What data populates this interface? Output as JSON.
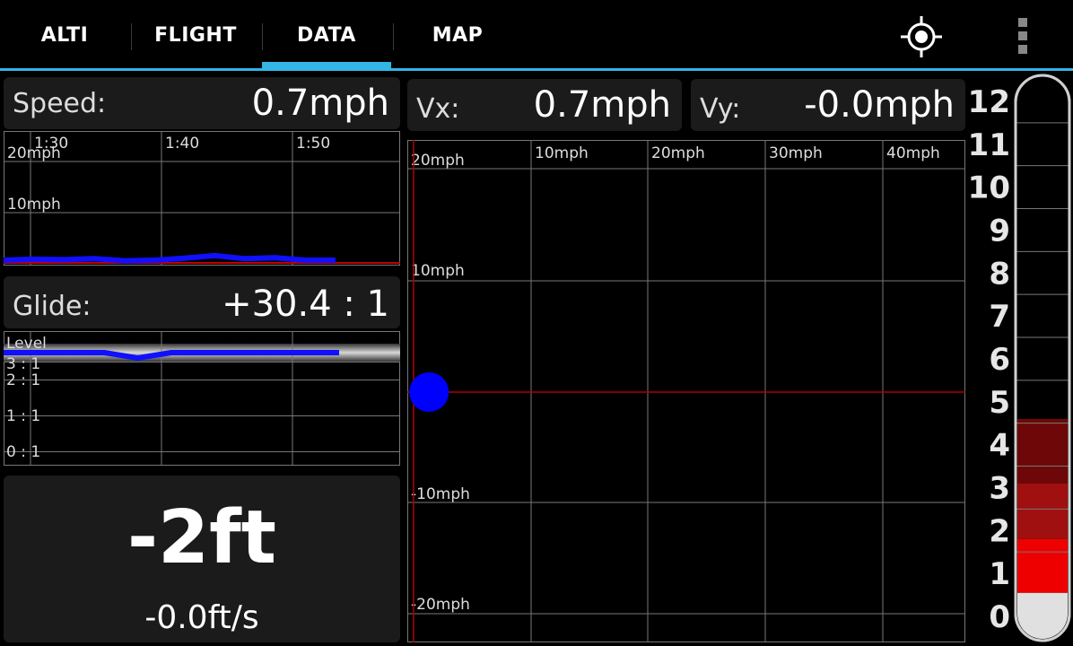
{
  "tabs": [
    {
      "label": "ALTI"
    },
    {
      "label": "FLIGHT"
    },
    {
      "label": "DATA"
    },
    {
      "label": "MAP"
    }
  ],
  "active_tab": "DATA",
  "accent_color": "#33b5e5",
  "icons": {
    "gps": "crosshair-target-icon",
    "menu": "overflow-menu-icon"
  },
  "speed": {
    "label": "Speed:",
    "value": "0.7mph"
  },
  "vx": {
    "label": "Vx:",
    "value": "0.7mph"
  },
  "vy": {
    "label": "Vy:",
    "value": "-0.0mph"
  },
  "glide": {
    "label": "Glide:",
    "value": "+30.4 : 1"
  },
  "altitude": {
    "value": "-2ft",
    "vspeed": "-0.0ft/s"
  },
  "chart_data": [
    {
      "type": "line",
      "x_tick_labels": [
        "1:30",
        "1:40",
        "1:50"
      ],
      "y_tick_labels": [
        "20mph",
        "10mph"
      ],
      "ylim": [
        0,
        20
      ],
      "series": [
        {
          "values": [
            0.7,
            0.9,
            0.8,
            1.0,
            0.6,
            0.7,
            1.1,
            1.6,
            1.0,
            1.2,
            0.7,
            0.7
          ]
        }
      ]
    },
    {
      "type": "line",
      "y_tick_labels": [
        "Level",
        "3 : 1",
        "2 : 1",
        "1 : 1",
        "0 : 1"
      ],
      "series": [
        {
          "values": [
            30,
            30,
            30,
            30,
            24,
            30,
            30,
            30,
            30,
            30,
            30
          ]
        }
      ]
    },
    {
      "type": "scatter",
      "x_tick_labels": [
        "10mph",
        "20mph",
        "30mph",
        "40mph"
      ],
      "y_tick_labels": [
        "20mph",
        "10mph",
        "-10mph",
        "-20mph"
      ],
      "xlim": [
        0,
        45
      ],
      "ylim": [
        -22,
        22
      ],
      "points": [
        {
          "x": 0.7,
          "y": 0.0
        }
      ],
      "point_color": "#0000ff"
    },
    {
      "type": "bar",
      "y_tick_labels": [
        "12",
        "11",
        "10",
        "9",
        "8",
        "7",
        "6",
        "5",
        "4",
        "3",
        "2",
        "1",
        "0"
      ],
      "ylim": [
        0,
        12
      ],
      "bands": [
        {
          "from": 0,
          "to": 0.55,
          "color": "#e0e0e0"
        },
        {
          "from": 0.55,
          "to": 1.8,
          "color": "#ee0000"
        },
        {
          "from": 1.8,
          "to": 3.1,
          "color": "#a01010"
        },
        {
          "from": 3.1,
          "to": 4.6,
          "color": "#6e0808"
        }
      ]
    }
  ]
}
